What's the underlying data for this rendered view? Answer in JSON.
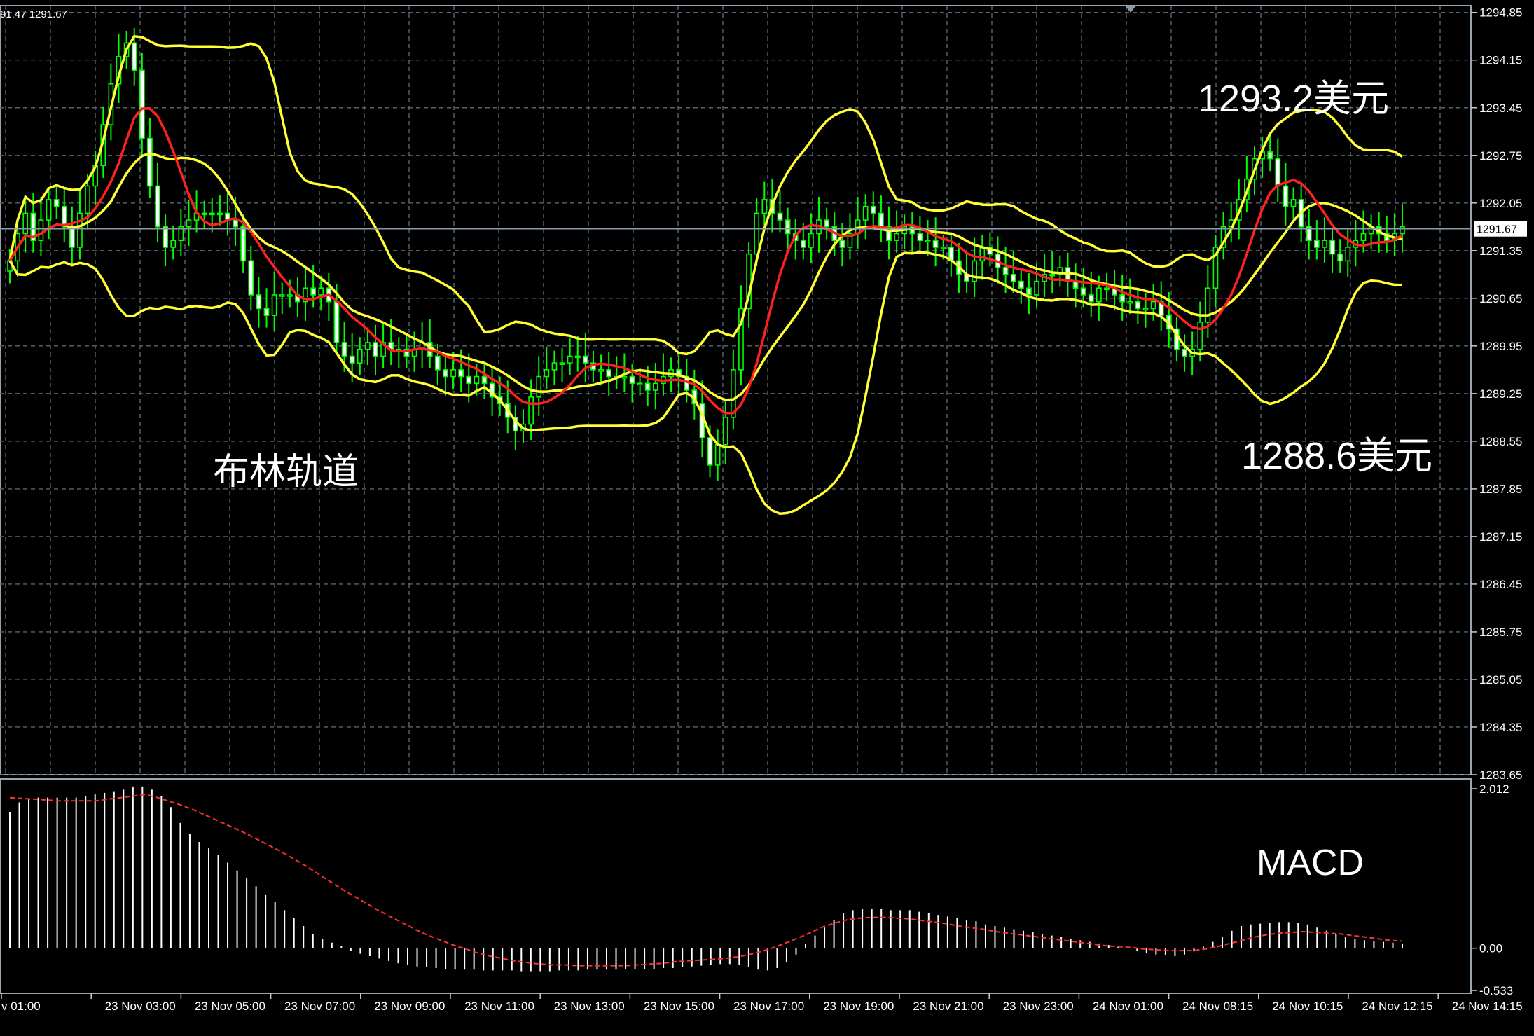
{
  "header": {
    "readout": "91,47 1291.67"
  },
  "annotations": {
    "upper": "1293.2美元",
    "lower": "1288.6美元",
    "bollinger": "布林轨道",
    "macd": "MACD"
  },
  "colors": {
    "background": "#000000",
    "grid": "#5a6470",
    "axis_text": "#ffffff",
    "candle": "#00ff00",
    "band": "#ffff33",
    "middle": "#ff2020",
    "signal": "#ff3030",
    "histogram": "#ffffff",
    "price_line": "#8a9aaa"
  },
  "chart_data": [
    {
      "type": "candlestick",
      "title": "",
      "current_price": 1291.67,
      "price_ticks": [
        "1294.85",
        "1294.15",
        "1293.45",
        "1292.75",
        "1292.05",
        "1291.35",
        "1290.65",
        "1289.95",
        "1289.25",
        "1288.55",
        "1287.85",
        "1287.15",
        "1286.45",
        "1285.75",
        "1285.05",
        "1284.35",
        "1283.65"
      ],
      "price_tick_values": [
        1294.85,
        1294.15,
        1293.45,
        1292.75,
        1292.05,
        1291.35,
        1290.65,
        1289.95,
        1289.25,
        1288.55,
        1287.85,
        1287.15,
        1286.45,
        1285.75,
        1285.05,
        1284.35,
        1283.65
      ],
      "ylim": [
        1283.65,
        1294.95
      ],
      "time_labels": [
        "v 01:00",
        "23 Nov 03:00",
        "23 Nov 05:00",
        "23 Nov 07:00",
        "23 Nov 09:00",
        "23 Nov 11:00",
        "23 Nov 13:00",
        "23 Nov 15:00",
        "23 Nov 17:00",
        "23 Nov 19:00",
        "23 Nov 21:00",
        "23 Nov 23:00",
        "24 Nov 01:00",
        "24 Nov 08:15",
        "24 Nov 10:15",
        "24 Nov 12:15",
        "24 Nov 14:15"
      ],
      "close": [
        1291.2,
        1291.6,
        1291.9,
        1291.5,
        1291.8,
        1292.1,
        1292.0,
        1291.7,
        1291.4,
        1291.9,
        1292.3,
        1292.6,
        1293.2,
        1293.8,
        1294.2,
        1294.4,
        1294.0,
        1293.0,
        1292.3,
        1291.7,
        1291.4,
        1291.5,
        1291.7,
        1291.8,
        1291.9,
        1291.9,
        1291.9,
        1291.9,
        1291.8,
        1291.7,
        1291.2,
        1290.7,
        1290.5,
        1290.4,
        1290.7,
        1290.7,
        1290.7,
        1290.6,
        1290.8,
        1290.7,
        1290.8,
        1290.6,
        1290.0,
        1289.8,
        1289.7,
        1289.9,
        1290.0,
        1289.8,
        1290.0,
        1289.9,
        1289.9,
        1289.8,
        1289.9,
        1290.0,
        1289.8,
        1289.6,
        1289.5,
        1289.6,
        1289.5,
        1289.4,
        1289.5,
        1289.4,
        1289.2,
        1289.1,
        1288.9,
        1288.7,
        1288.8,
        1289.2,
        1289.5,
        1289.6,
        1289.7,
        1289.7,
        1289.8,
        1289.8,
        1289.7,
        1289.6,
        1289.6,
        1289.5,
        1289.5,
        1289.5,
        1289.4,
        1289.4,
        1289.3,
        1289.4,
        1289.5,
        1289.6,
        1289.5,
        1289.3,
        1289.1,
        1288.6,
        1288.2,
        1288.5,
        1288.9,
        1289.6,
        1290.5,
        1291.3,
        1291.9,
        1292.1,
        1291.9,
        1291.8,
        1291.6,
        1291.5,
        1291.4,
        1291.6,
        1291.8,
        1291.7,
        1291.5,
        1291.4,
        1291.6,
        1291.8,
        1292.0,
        1291.9,
        1291.7,
        1291.5,
        1291.6,
        1291.7,
        1291.6,
        1291.5,
        1291.5,
        1291.4,
        1291.4,
        1291.2,
        1291.0,
        1290.9,
        1291.2,
        1291.4,
        1291.3,
        1291.1,
        1291.0,
        1290.9,
        1290.8,
        1290.7,
        1290.9,
        1291.0,
        1291.0,
        1291.1,
        1290.9,
        1290.8,
        1290.7,
        1290.6,
        1290.8,
        1290.8,
        1290.7,
        1290.6,
        1290.6,
        1290.5,
        1290.5,
        1290.6,
        1290.4,
        1290.2,
        1289.9,
        1289.8,
        1289.9,
        1290.3,
        1290.8,
        1291.4,
        1291.7,
        1291.8,
        1292.1,
        1292.4,
        1292.7,
        1292.8,
        1292.7,
        1292.3,
        1292.0,
        1292.1,
        1291.7,
        1291.5,
        1291.4,
        1291.5,
        1291.3,
        1291.2,
        1291.4,
        1291.5,
        1291.6,
        1291.7,
        1291.6,
        1291.5,
        1291.6,
        1291.7
      ]
    },
    {
      "type": "bar",
      "title": "",
      "ticks": [
        "2.012",
        "0.00",
        "-0.533"
      ],
      "tick_values": [
        2.012,
        0.0,
        -0.533
      ],
      "ylim": [
        -0.533,
        2.012
      ],
      "histogram": [
        1.72,
        1.84,
        1.88,
        1.9,
        1.9,
        1.9,
        1.9,
        1.9,
        1.92,
        1.94,
        1.96,
        1.98,
        2.0,
        2.04,
        2.04,
        2.0,
        1.92,
        1.78,
        1.58,
        1.44,
        1.34,
        1.26,
        1.18,
        1.08,
        0.98,
        0.88,
        0.78,
        0.68,
        0.58,
        0.48,
        0.38,
        0.28,
        0.18,
        0.12,
        0.07,
        0.03,
        -0.03,
        -0.07,
        -0.1,
        -0.13,
        -0.16,
        -0.19,
        -0.21,
        -0.23,
        -0.24,
        -0.25,
        -0.26,
        -0.27,
        -0.27,
        -0.27,
        -0.28,
        -0.28,
        -0.28,
        -0.28,
        -0.29,
        -0.29,
        -0.29,
        -0.29,
        -0.28,
        -0.28,
        -0.28,
        -0.27,
        -0.27,
        -0.27,
        -0.27,
        -0.26,
        -0.26,
        -0.26,
        -0.26,
        -0.25,
        -0.25,
        -0.24,
        -0.23,
        -0.22,
        -0.21,
        -0.2,
        -0.2,
        -0.21,
        -0.24,
        -0.27,
        -0.28,
        -0.25,
        -0.18,
        -0.08,
        0.05,
        0.16,
        0.26,
        0.36,
        0.44,
        0.48,
        0.5,
        0.5,
        0.5,
        0.48,
        0.48,
        0.48,
        0.46,
        0.44,
        0.42,
        0.4,
        0.38,
        0.36,
        0.34,
        0.3,
        0.28,
        0.26,
        0.24,
        0.22,
        0.2,
        0.18,
        0.16,
        0.14,
        0.12,
        0.1,
        0.08,
        0.06,
        0.04,
        0.02,
        0.0,
        -0.03,
        -0.06,
        -0.08,
        -0.09,
        -0.1,
        -0.08,
        -0.04,
        0.02,
        0.08,
        0.14,
        0.22,
        0.28,
        0.3,
        0.31,
        0.32,
        0.33,
        0.33,
        0.32,
        0.3,
        0.26,
        0.22,
        0.18,
        0.14,
        0.12,
        0.1,
        0.09,
        0.08,
        0.07,
        0.06
      ],
      "signal": [
        1.9,
        1.89,
        1.88,
        1.87,
        1.86,
        1.86,
        1.86,
        1.86,
        1.88,
        1.9,
        1.92,
        1.94,
        1.9,
        1.85,
        1.8,
        1.74,
        1.67,
        1.6,
        1.53,
        1.46,
        1.38,
        1.3,
        1.22,
        1.13,
        1.04,
        0.94,
        0.84,
        0.74,
        0.65,
        0.56,
        0.47,
        0.39,
        0.31,
        0.23,
        0.16,
        0.1,
        0.04,
        -0.01,
        -0.06,
        -0.1,
        -0.13,
        -0.16,
        -0.18,
        -0.2,
        -0.21,
        -0.21,
        -0.22,
        -0.22,
        -0.22,
        -0.22,
        -0.22,
        -0.21,
        -0.2,
        -0.19,
        -0.17,
        -0.16,
        -0.15,
        -0.14,
        -0.13,
        -0.11,
        -0.08,
        -0.04,
        0.01,
        0.07,
        0.13,
        0.2,
        0.27,
        0.32,
        0.36,
        0.38,
        0.39,
        0.39,
        0.38,
        0.37,
        0.35,
        0.33,
        0.31,
        0.28,
        0.26,
        0.24,
        0.21,
        0.19,
        0.17,
        0.15,
        0.13,
        0.11,
        0.09,
        0.07,
        0.05,
        0.03,
        0.02,
        0.01,
        -0.01,
        -0.02,
        -0.03,
        -0.03,
        -0.03,
        -0.01,
        0.02,
        0.06,
        0.1,
        0.14,
        0.17,
        0.19,
        0.2,
        0.21,
        0.2,
        0.19,
        0.18,
        0.16,
        0.14,
        0.12,
        0.1,
        0.09
      ]
    }
  ]
}
